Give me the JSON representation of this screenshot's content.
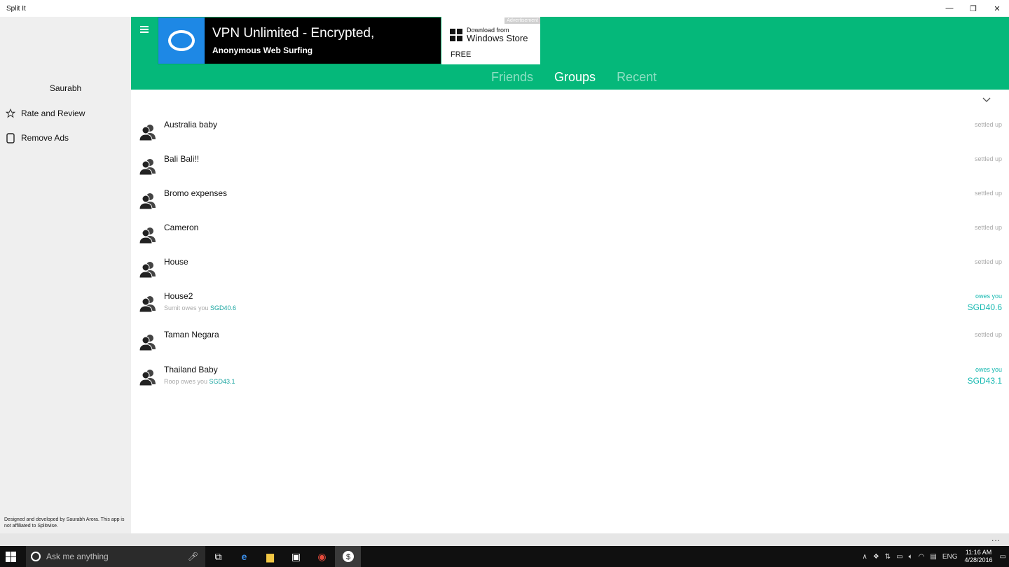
{
  "window": {
    "title": "Split It",
    "minimize": "—",
    "maximize": "❐",
    "close": "✕"
  },
  "sidebar": {
    "username": "Saurabh",
    "items": [
      {
        "label": "Rate and Review",
        "icon": "star-icon"
      },
      {
        "label": "Remove Ads",
        "icon": "device-icon"
      }
    ],
    "footer": "Designed and developed by Saurabh Arora. This app is not affiliated to Splitwise."
  },
  "ad": {
    "headline": "VPN Unlimited - Encrypted,",
    "subline": "Anonymous Web Surfing",
    "tag": "Advertisement",
    "download_from": "Download from",
    "store": "Windows Store",
    "price": "FREE"
  },
  "tabs": [
    {
      "label": "Friends",
      "active": false
    },
    {
      "label": "Groups",
      "active": true
    },
    {
      "label": "Recent",
      "active": false
    }
  ],
  "groups": [
    {
      "name": "Australia baby",
      "status": "settled up"
    },
    {
      "name": "Bali Bali!!",
      "status": "settled up"
    },
    {
      "name": "Bromo expenses",
      "status": "settled up"
    },
    {
      "name": "Cameron",
      "status": "settled up"
    },
    {
      "name": "House",
      "status": "settled up"
    },
    {
      "name": "House2",
      "status": "owes you",
      "amount": "SGD40.6",
      "sub_text": "Sumit owes you ",
      "sub_amount": "SGD40.6"
    },
    {
      "name": "Taman Negara",
      "status": "settled up"
    },
    {
      "name": "Thailand Baby",
      "status": "owes you",
      "amount": "SGD43.1",
      "sub_text": "Roop owes you ",
      "sub_amount": "SGD43.1"
    }
  ],
  "appbar": {
    "more": "..."
  },
  "taskbar": {
    "search_placeholder": "Ask me anything",
    "language": "ENG",
    "time": "11:16 AM",
    "date": "4/28/2016"
  },
  "colors": {
    "accent": "#05b87a",
    "owe": "#14b8b0"
  }
}
